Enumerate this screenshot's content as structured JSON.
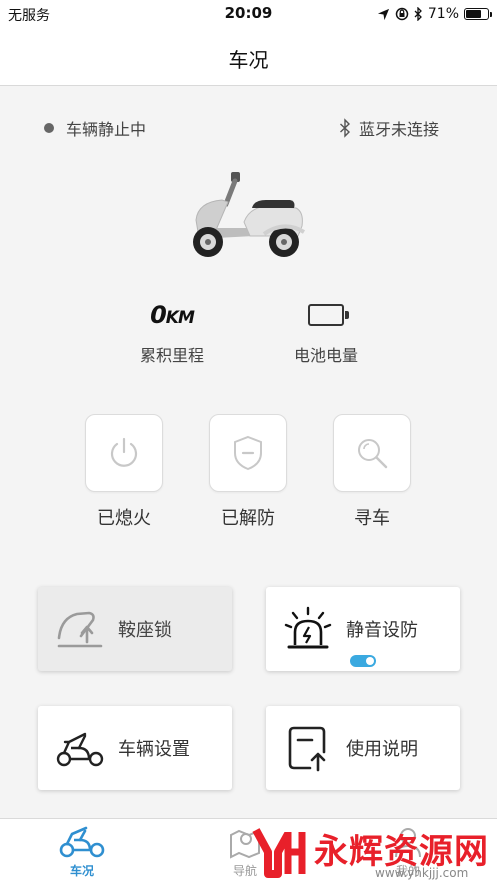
{
  "status_bar": {
    "carrier": "无服务",
    "time": "20:09",
    "battery_percent": "71%",
    "battery_level": 0.71,
    "icons": [
      "location-arrow-icon",
      "rotation-lock-icon",
      "bluetooth-icon",
      "battery-icon"
    ]
  },
  "nav": {
    "title": "车况"
  },
  "vehicle_state": {
    "motion_status": "车辆静止中",
    "bluetooth_status": "蓝牙未连接"
  },
  "stats": {
    "mileage_value": "0",
    "mileage_unit": "KM",
    "mileage_label": "累积里程",
    "battery_label": "电池电量"
  },
  "controls": [
    {
      "label": "已熄火",
      "icon": "power-icon"
    },
    {
      "label": "已解防",
      "icon": "shield-icon"
    },
    {
      "label": "寻车",
      "icon": "search-icon"
    }
  ],
  "cards": {
    "seat_lock": "鞍座锁",
    "silent_arm": "静音设防",
    "silent_arm_toggle_on": true,
    "vehicle_settings": "车辆设置",
    "manual": "使用说明"
  },
  "tabs": [
    {
      "label": "车况",
      "icon": "scooter-icon",
      "active": true
    },
    {
      "label": "导航",
      "icon": "map-pin-icon",
      "active": false
    },
    {
      "label": "我的",
      "icon": "person-icon",
      "active": false
    }
  ],
  "watermark": {
    "brand_text": "永辉资源网",
    "url": "www.yhkjjj.com"
  },
  "colors": {
    "accent": "#3aa9e0",
    "tab_active": "#2f8fd0",
    "watermark": "#e8202a",
    "card_shadow_bg": "#f4f4f4"
  }
}
